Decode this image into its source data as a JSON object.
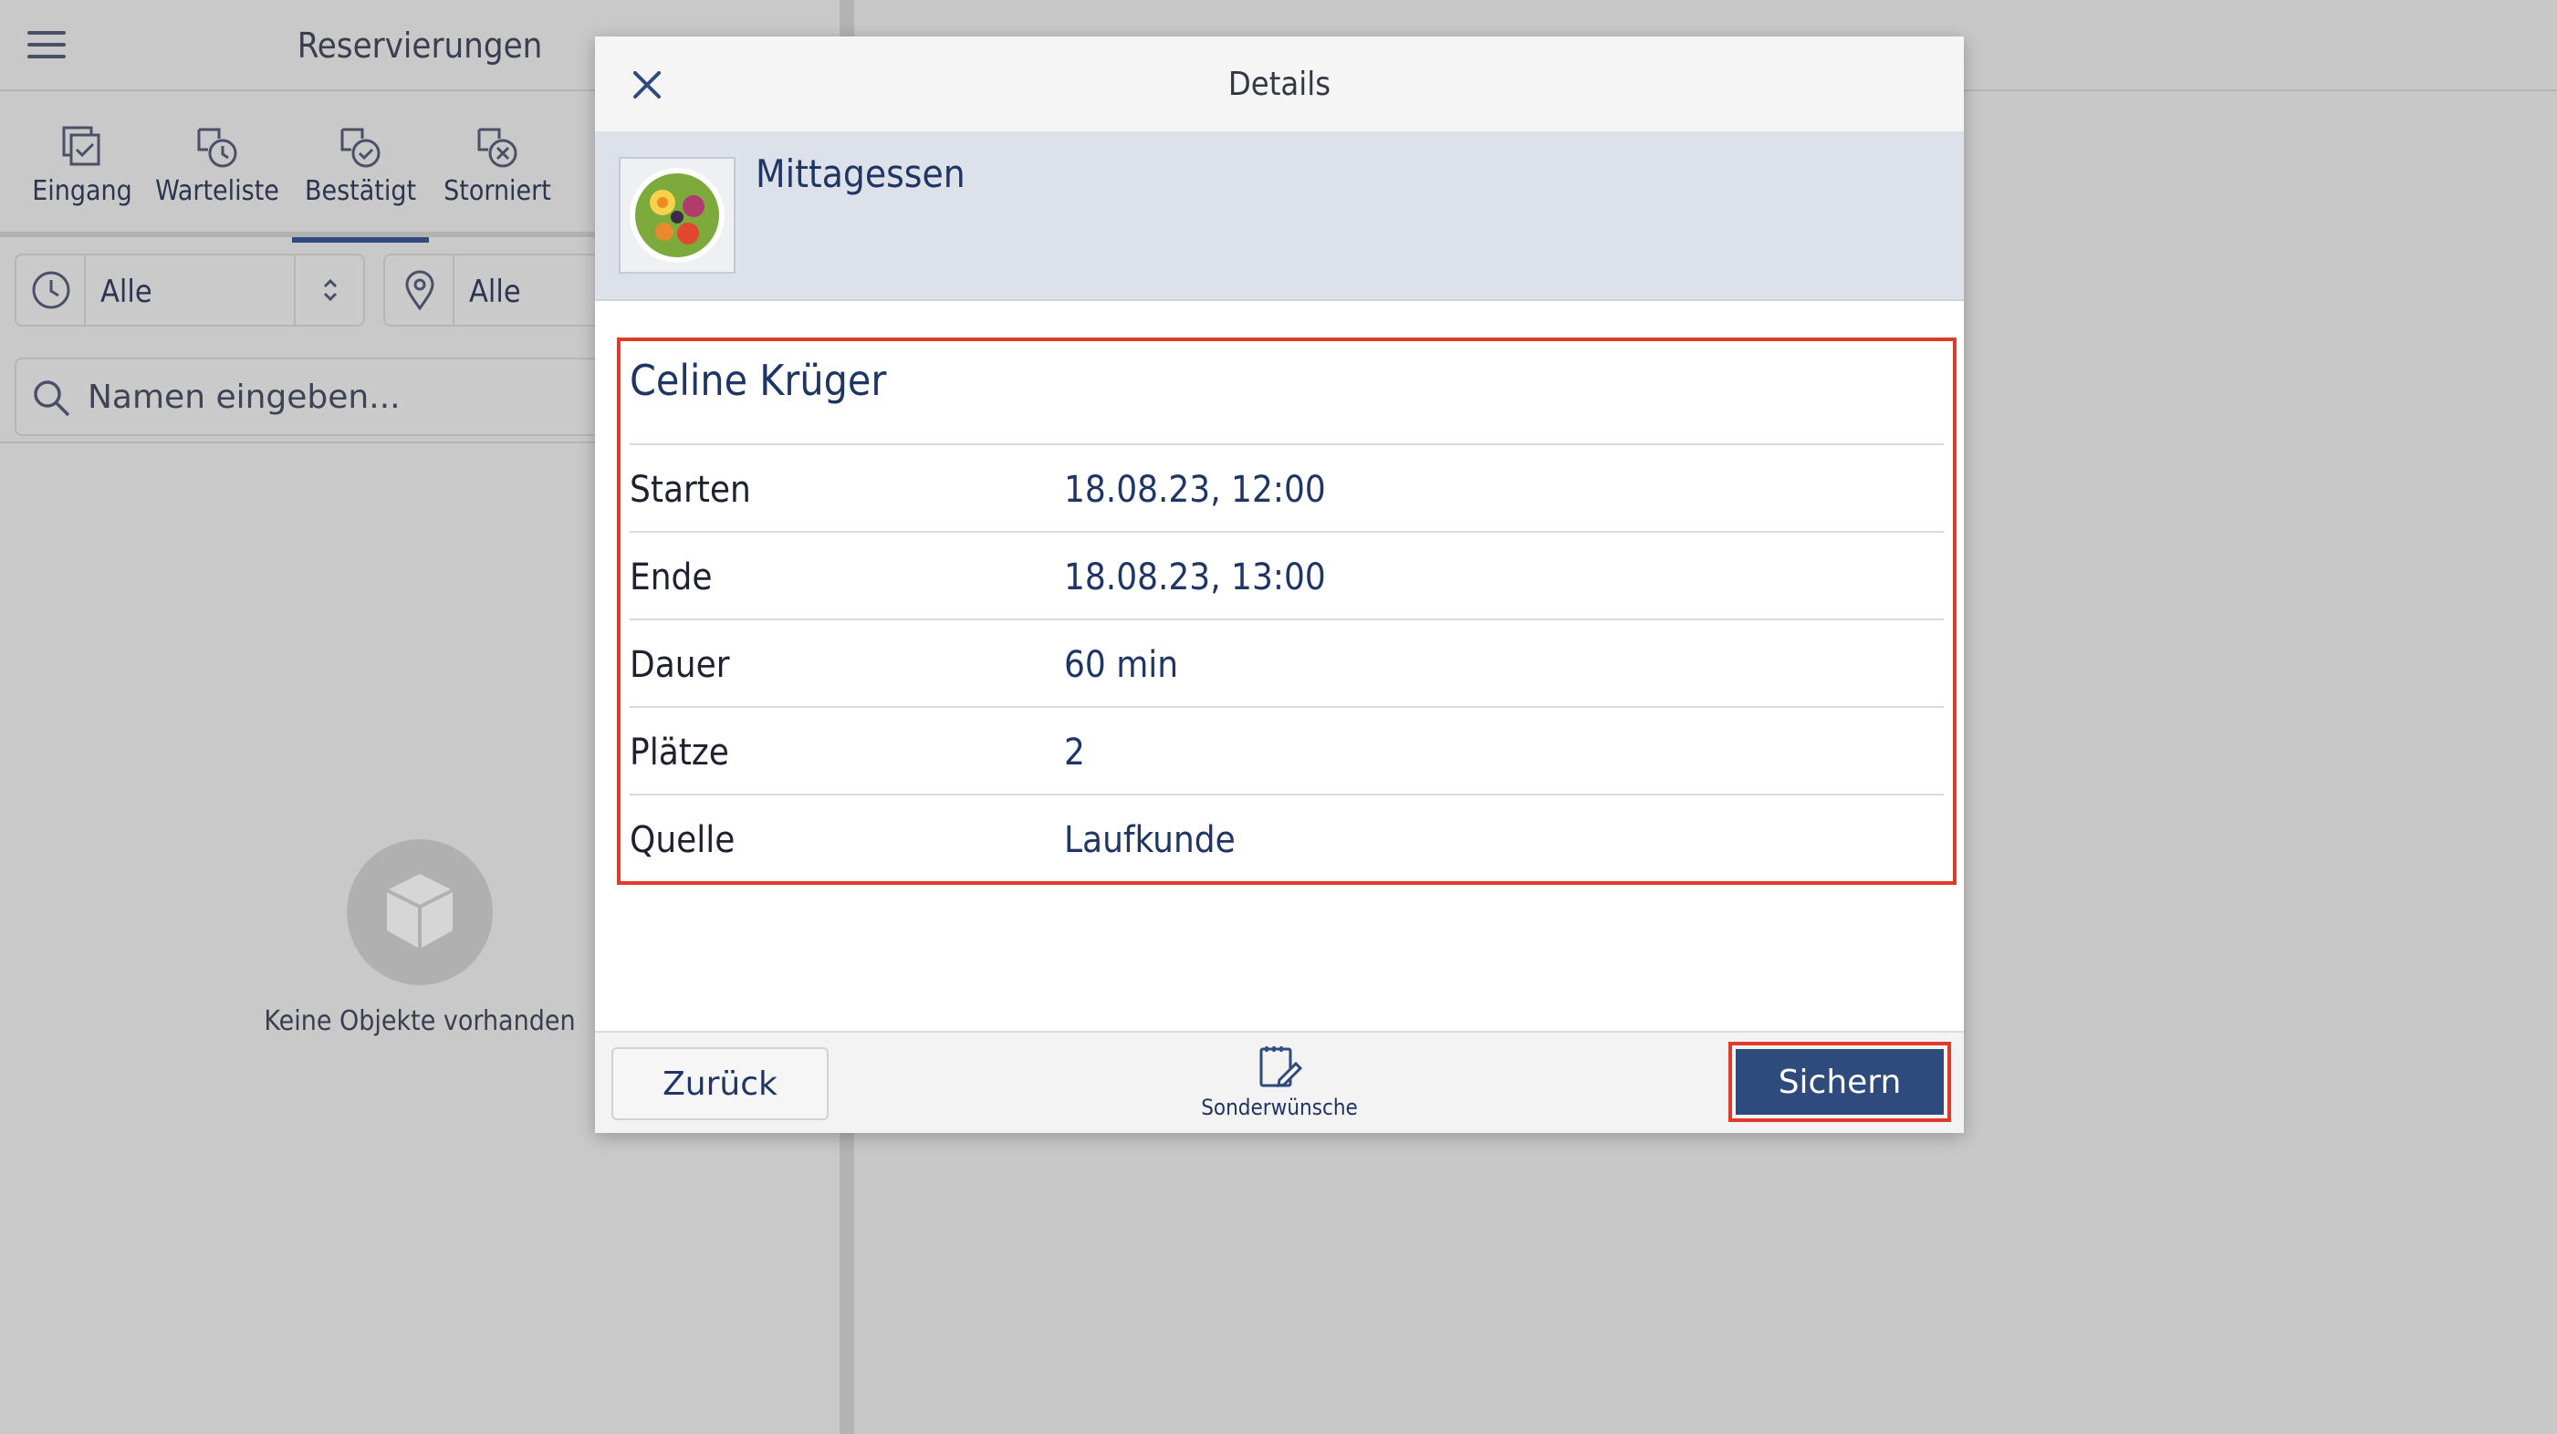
{
  "left_panel": {
    "title": "Reservierungen",
    "tabs": [
      {
        "label": "Eingang",
        "icon": "inbox-icon"
      },
      {
        "label": "Warteliste",
        "icon": "waitlist-icon"
      },
      {
        "label": "Bestätigt",
        "icon": "confirmed-icon",
        "active": true
      },
      {
        "label": "Storniert",
        "icon": "cancelled-icon"
      }
    ],
    "time_filter": {
      "value": "Alle",
      "icon": "clock-icon"
    },
    "location_filter": {
      "value": "Alle",
      "icon": "location-pin-icon"
    },
    "search": {
      "placeholder": "Namen eingeben...",
      "value": ""
    },
    "empty_state": {
      "text": "Keine Objekte vorhanden",
      "icon": "empty-box-icon"
    }
  },
  "modal": {
    "title": "Details",
    "event": {
      "name": "Mittagessen"
    },
    "guest_name": "Celine Krüger",
    "rows": [
      {
        "label": "Starten",
        "value": "18.08.23, 12:00"
      },
      {
        "label": "Ende",
        "value": "18.08.23, 13:00"
      },
      {
        "label": "Dauer",
        "value": "60 min"
      },
      {
        "label": "Plätze",
        "value": "2"
      },
      {
        "label": "Quelle",
        "value": "Laufkunde"
      }
    ],
    "footer": {
      "back_label": "Zurück",
      "special_label": "Sonderwünsche",
      "save_label": "Sichern"
    }
  },
  "colors": {
    "accent": "#2f4a7d",
    "highlight": "#e03b2a",
    "text_value": "#1f3566"
  }
}
